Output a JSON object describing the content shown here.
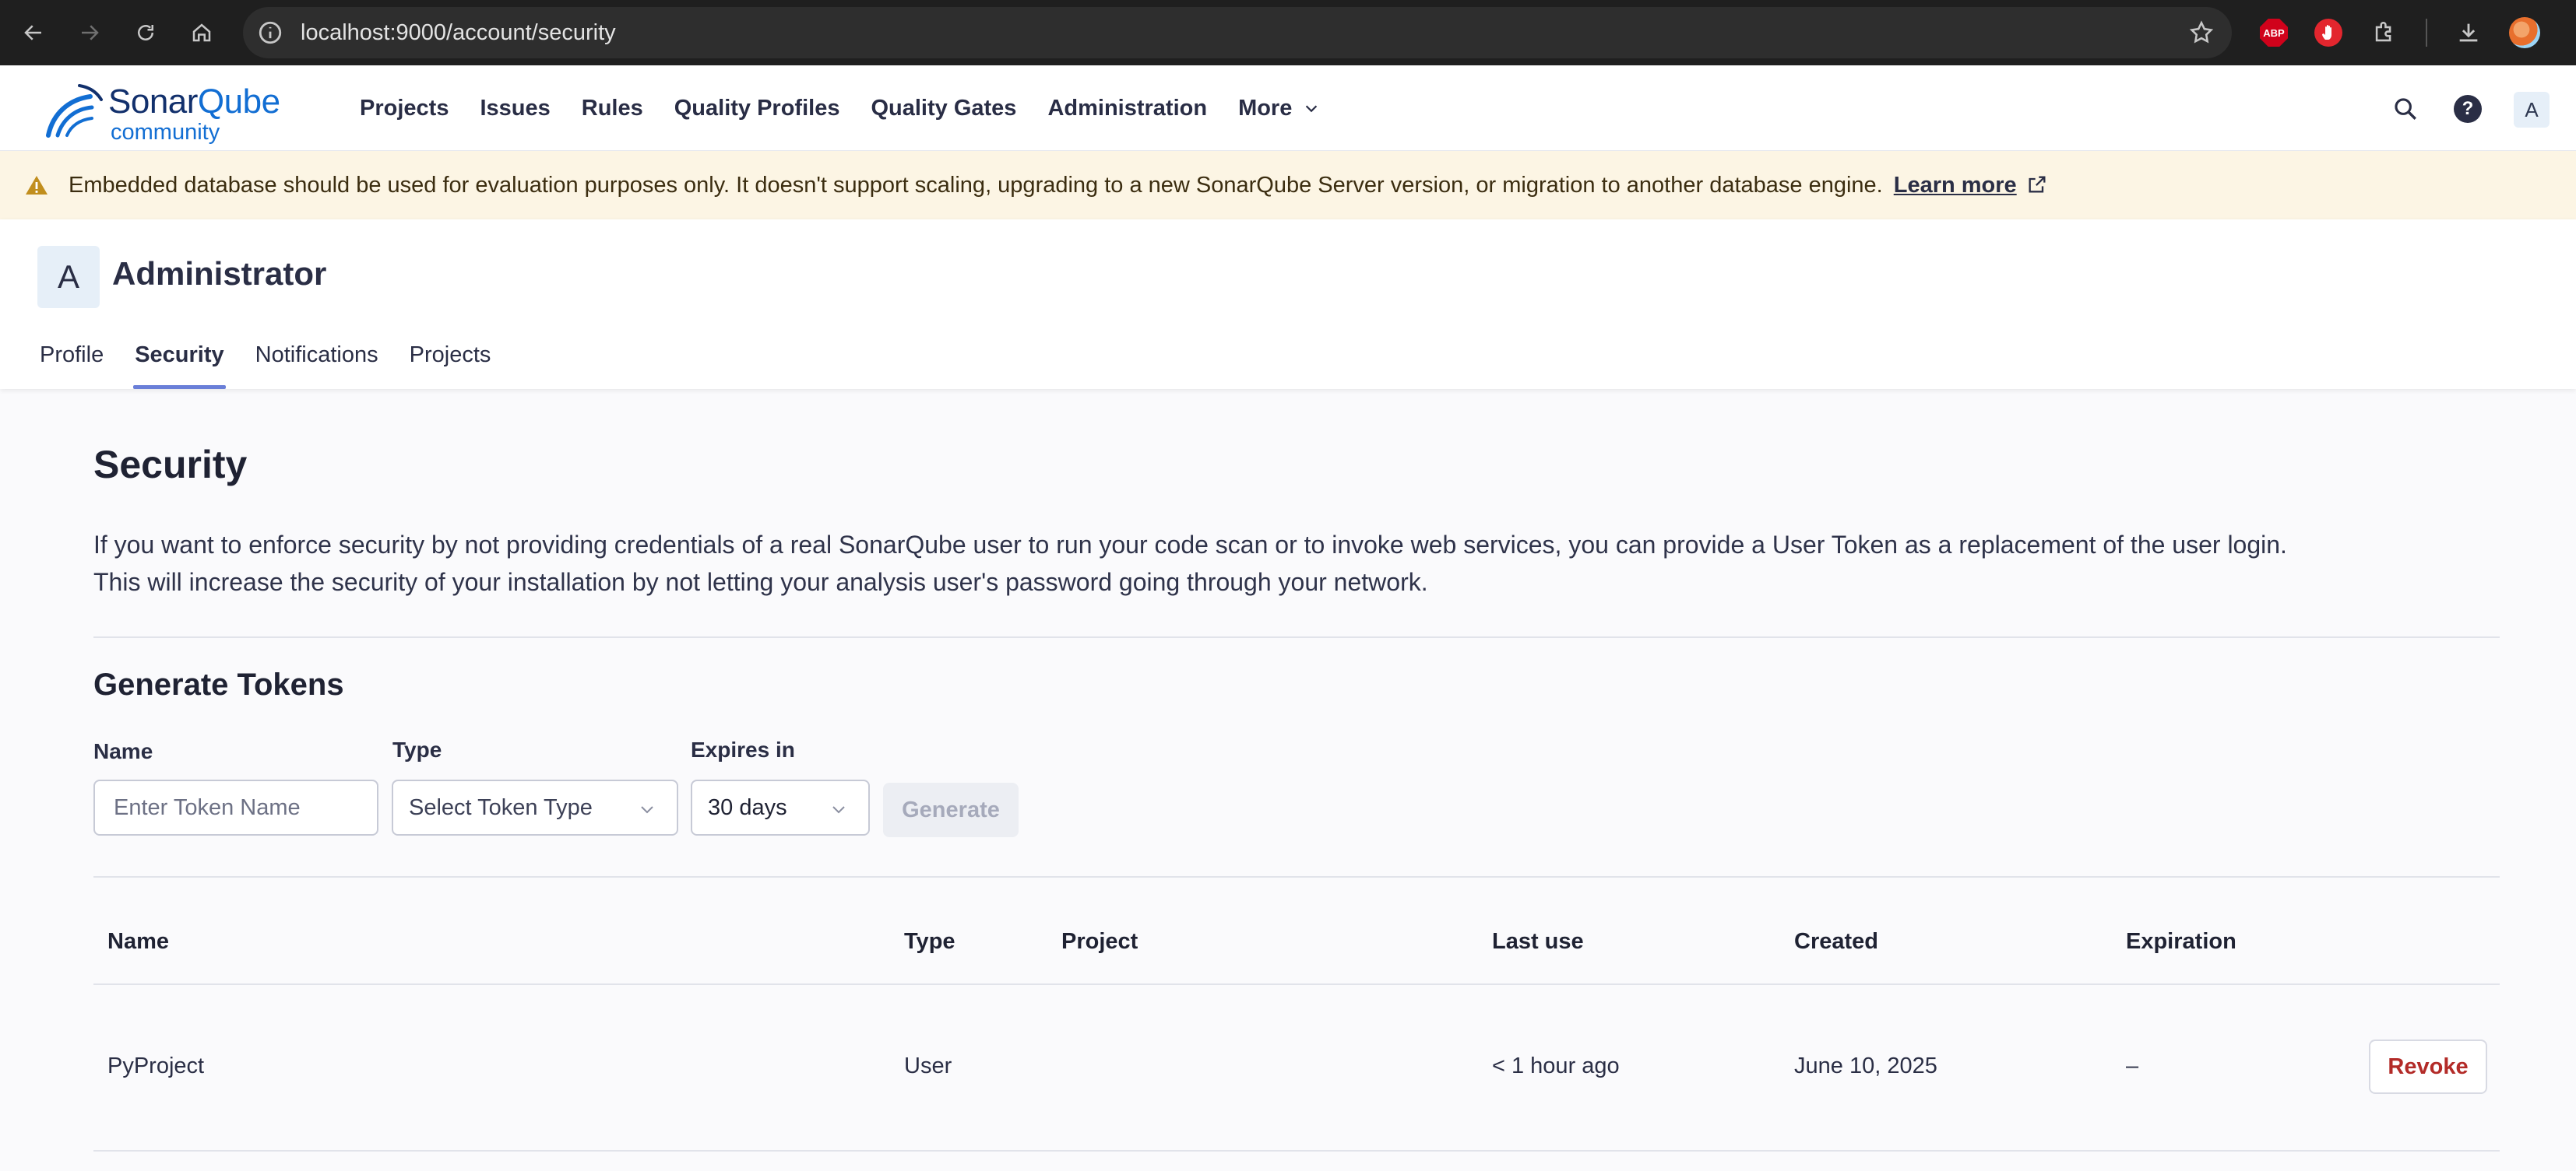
{
  "browser": {
    "url": "localhost:9000/account/security",
    "extensions": {
      "abp_label": "ABP"
    }
  },
  "header": {
    "logo": {
      "brand_a": "Sonar",
      "brand_b": "Qube",
      "edition": "community"
    },
    "nav": [
      {
        "label": "Projects"
      },
      {
        "label": "Issues"
      },
      {
        "label": "Rules"
      },
      {
        "label": "Quality Profiles"
      },
      {
        "label": "Quality Gates"
      },
      {
        "label": "Administration"
      },
      {
        "label": "More"
      }
    ],
    "help_glyph": "?",
    "user_initial": "A"
  },
  "banner": {
    "text": "Embedded database should be used for evaluation purposes only. It doesn't support scaling, upgrading to a new SonarQube Server version, or migration to another database engine.",
    "link": "Learn more",
    "color": "#fcf5e4"
  },
  "account": {
    "initial": "A",
    "name": "Administrator",
    "tabs": [
      {
        "label": "Profile"
      },
      {
        "label": "Security"
      },
      {
        "label": "Notifications"
      },
      {
        "label": "Projects"
      }
    ],
    "active_tab": "Security"
  },
  "security": {
    "title": "Security",
    "description_line1": "If you want to enforce security by not providing credentials of a real SonarQube user to run your code scan or to invoke web services, you can provide a User Token as a replacement of the user login.",
    "description_line2": "This will increase the security of your installation by not letting your analysis user's password going through your network."
  },
  "generate": {
    "title": "Generate Tokens",
    "name_label": "Name",
    "name_placeholder": "Enter Token Name",
    "type_label": "Type",
    "type_placeholder": "Select Token Type",
    "expires_label": "Expires in",
    "expires_value": "30 days",
    "button": "Generate"
  },
  "tokens_table": {
    "columns": [
      "Name",
      "Type",
      "Project",
      "Last use",
      "Created",
      "Expiration"
    ],
    "rows": [
      {
        "name": "PyProject",
        "type": "User",
        "project": "",
        "last_use": "< 1 hour ago",
        "created": "June 10, 2025",
        "expiration": "–",
        "action": "Revoke"
      }
    ]
  },
  "colors": {
    "accent_tab": "#6a7fd8",
    "revoke_text": "#b32b28",
    "brand_dark": "#12306c",
    "brand_blue": "#126ed3"
  }
}
